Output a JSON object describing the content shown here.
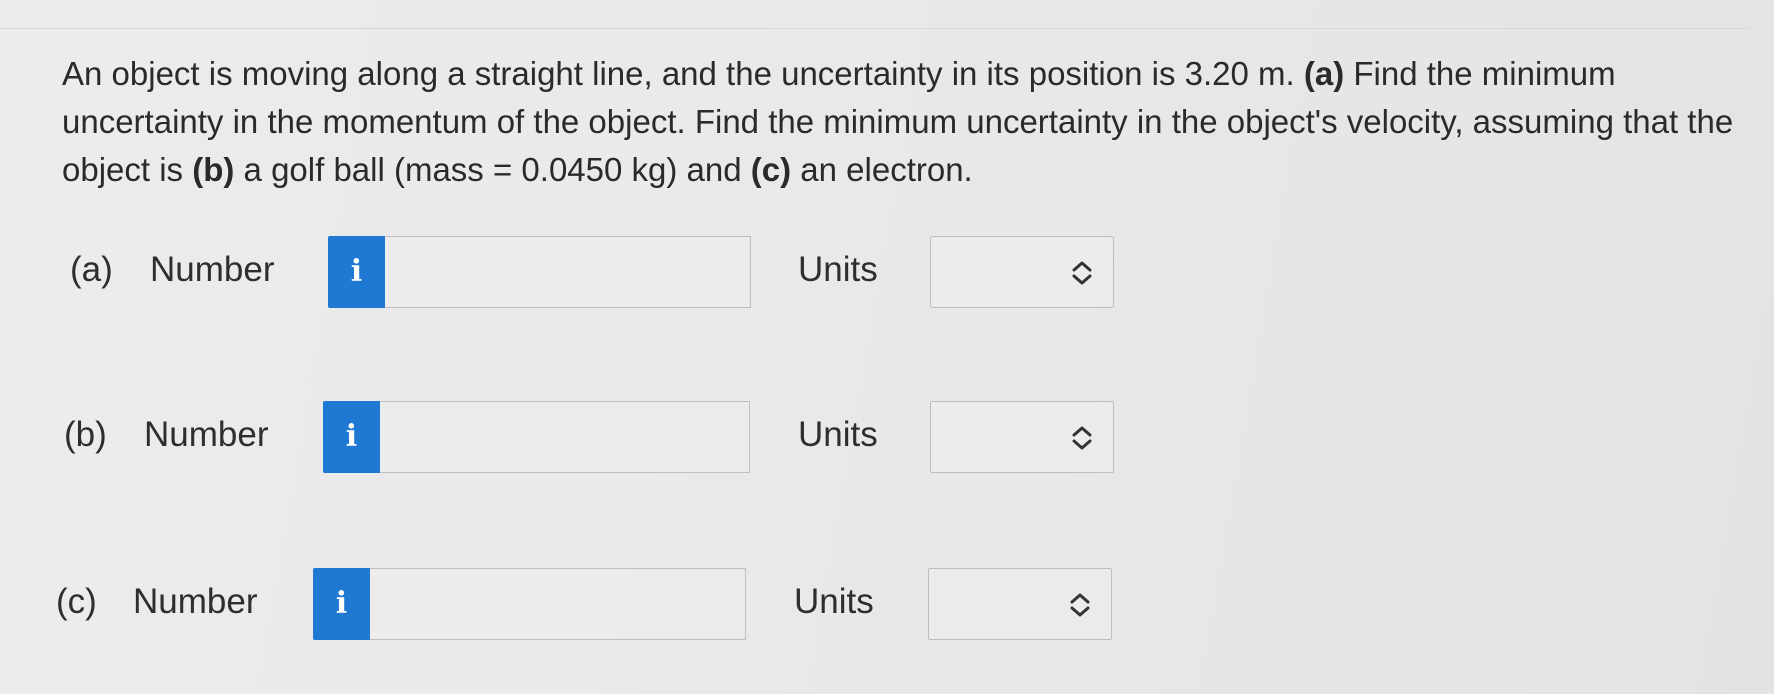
{
  "question": {
    "text_1": "An object is moving along a straight line, and the uncertainty in its position is 3.20 m. ",
    "part_a_marker": "(a)",
    "text_2": " Find the minimum uncertainty in the momentum of the object. Find the minimum uncertainty in the object's velocity, assuming that the object is ",
    "part_b_marker": "(b)",
    "text_3": " a golf ball (mass = 0.0450 kg) and ",
    "part_c_marker": "(c)",
    "text_4": " an electron."
  },
  "rows": [
    {
      "part_label": "(a)",
      "number_label": "Number",
      "info_icon_glyph": "i",
      "number_value": "",
      "units_label": "Units",
      "units_selected": ""
    },
    {
      "part_label": "(b)",
      "number_label": "Number",
      "info_icon_glyph": "i",
      "number_value": "",
      "units_label": "Units",
      "units_selected": ""
    },
    {
      "part_label": "(c)",
      "number_label": "Number",
      "info_icon_glyph": "i",
      "number_value": "",
      "units_label": "Units",
      "units_selected": ""
    }
  ],
  "icons": {
    "info": "info-icon",
    "select_arrows": "chevron-up-down-icon"
  },
  "colors": {
    "info_badge": "#1f78d1",
    "background": "#e9e9e9",
    "text": "#2b2b2b"
  }
}
